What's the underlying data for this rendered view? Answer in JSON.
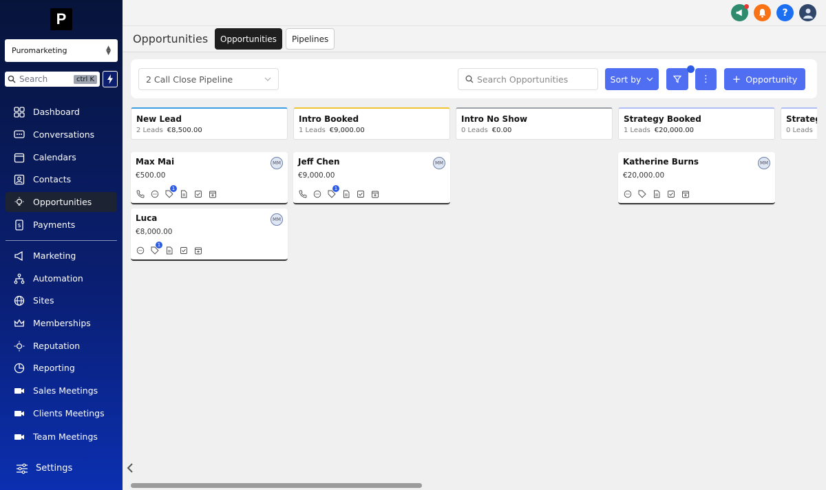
{
  "sidebar": {
    "logo_letter": "P",
    "account_name": "Puromarketing",
    "search_placeholder": "Search",
    "search_shortcut": "ctrl K",
    "items": [
      {
        "label": "Dashboard",
        "icon": "dashboard-icon"
      },
      {
        "label": "Conversations",
        "icon": "chat-icon"
      },
      {
        "label": "Calendars",
        "icon": "calendar-icon"
      },
      {
        "label": "Contacts",
        "icon": "contacts-icon"
      },
      {
        "label": "Opportunities",
        "icon": "bulb-icon",
        "active": true
      },
      {
        "label": "Payments",
        "icon": "payments-icon"
      },
      {
        "label": "Marketing",
        "icon": "megaphone-icon"
      },
      {
        "label": "Automation",
        "icon": "automation-icon"
      },
      {
        "label": "Sites",
        "icon": "globe-icon"
      },
      {
        "label": "Memberships",
        "icon": "crown-icon"
      },
      {
        "label": "Reputation",
        "icon": "star-icon"
      },
      {
        "label": "Reporting",
        "icon": "pie-chart-icon"
      },
      {
        "label": "Sales Meetings",
        "icon": "video-icon"
      },
      {
        "label": "Clients Meetings",
        "icon": "video-icon"
      },
      {
        "label": "Team Meetings",
        "icon": "video-icon"
      }
    ],
    "settings_label": "Settings"
  },
  "header": {
    "title": "Opportunities",
    "tabs": [
      {
        "label": "Opportunities",
        "active": true
      },
      {
        "label": "Pipelines",
        "active": false
      }
    ]
  },
  "filters": {
    "pipeline": "2 Call Close Pipeline",
    "search_placeholder": "Search Opportunities",
    "sort_label": "Sort by",
    "add_label": "Opportunity"
  },
  "colors": {
    "accent": "#4f6ef2",
    "new_lead_top": "#3b9ee0",
    "intro_booked_top": "#f0c430",
    "intro_no_show_top": "#9aa0a6",
    "strategy_booked_top": "#b0bdf5"
  },
  "columns": [
    {
      "name": "New Lead",
      "leads": "2 Leads",
      "amount": "€8,500.00",
      "cards": [
        {
          "name": "Max Mai",
          "amount": "€500.00",
          "initials": "MM",
          "icons": [
            "phone",
            "chat",
            "tag",
            "doc",
            "check",
            "calendar"
          ],
          "badge": "1"
        },
        {
          "name": "Luca",
          "amount": "€8,000.00",
          "initials": "MM",
          "icons": [
            "chat",
            "tag",
            "doc",
            "check",
            "calendar"
          ],
          "badge": "1"
        }
      ]
    },
    {
      "name": "Intro Booked",
      "leads": "1 Leads",
      "amount": "€9,000.00",
      "cards": [
        {
          "name": "Jeff Chen",
          "amount": "€9,000.00",
          "initials": "MM",
          "icons": [
            "phone",
            "chat",
            "tag",
            "doc",
            "check",
            "calendar"
          ],
          "badge": "1"
        }
      ]
    },
    {
      "name": "Intro No Show",
      "leads": "0 Leads",
      "amount": "€0.00",
      "cards": []
    },
    {
      "name": "Strategy Booked",
      "leads": "1 Leads",
      "amount": "€20,000.00",
      "cards": [
        {
          "name": "Katherine Burns",
          "amount": "€20,000.00",
          "initials": "MM",
          "icons": [
            "chat",
            "tag",
            "doc",
            "check",
            "calendar"
          ],
          "badge": ""
        }
      ]
    },
    {
      "name": "Strategy",
      "leads": "0 Leads",
      "amount": "",
      "cards": []
    }
  ]
}
